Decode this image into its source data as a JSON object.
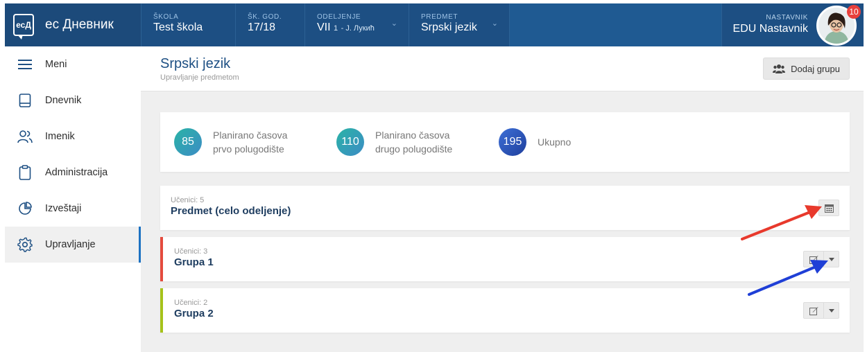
{
  "brand": {
    "logo_text": "есД",
    "name": "ес Дневник"
  },
  "header": {
    "school": {
      "label": "ŠKOLA",
      "value": "Test škola"
    },
    "year": {
      "label": "ŠK. GOD.",
      "value": "17/18"
    },
    "class": {
      "label": "ODELJENJE",
      "value": "VII",
      "sub": "1",
      "teacher": "- Ј. Лукић"
    },
    "subject": {
      "label": "PREDMET",
      "value": "Srpski jezik"
    },
    "user": {
      "label": "NASTAVNIK",
      "name": "EDU Nastavnik",
      "notifications": "10"
    }
  },
  "sidebar": {
    "items": [
      {
        "label": "Meni",
        "icon": "hamburger-icon"
      },
      {
        "label": "Dnevnik",
        "icon": "book-icon"
      },
      {
        "label": "Imenik",
        "icon": "users-icon"
      },
      {
        "label": "Administracija",
        "icon": "clipboard-icon"
      },
      {
        "label": "Izveštaji",
        "icon": "pie-chart-icon"
      },
      {
        "label": "Upravljanje",
        "icon": "gear-icon",
        "active": true
      }
    ]
  },
  "page": {
    "title": "Srpski jezik",
    "subtitle": "Upravljanje predmetom",
    "add_group_label": "Dodaj grupu"
  },
  "stats": [
    {
      "value": "85",
      "label": "Planirano časova prvo polugodište",
      "color": "#2ab3a6"
    },
    {
      "value": "110",
      "label": "Planirano časova drugo polugodište",
      "color": "#2ab3a6"
    },
    {
      "value": "195",
      "label": "Ukupno",
      "color": "#2f55c0"
    }
  ],
  "groups": [
    {
      "count_label": "Učenici: 5",
      "name": "Predmet (celo odeljenje)",
      "accent": ""
    },
    {
      "count_label": "Učenici: 3",
      "name": "Grupa 1",
      "accent": "#e44b3e"
    },
    {
      "count_label": "Učenici: 2",
      "name": "Grupa 2",
      "accent": "#a6c21a"
    }
  ],
  "annotations": {
    "red_arrow_color": "#e8392c",
    "blue_arrow_color": "#1f3fd6"
  }
}
